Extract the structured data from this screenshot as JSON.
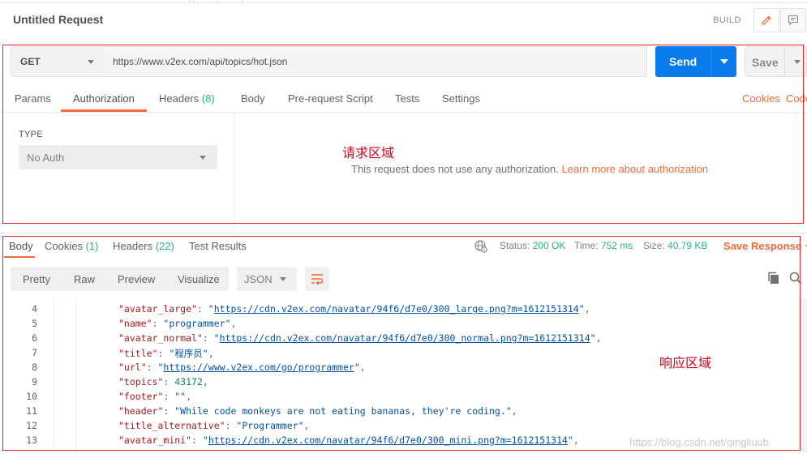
{
  "header": {
    "title": "Untitled Request",
    "build_label": "BUILD"
  },
  "request": {
    "method": "GET",
    "url": "https://www.v2ex.com/api/topics/hot.json",
    "send_label": "Send",
    "save_label": "Save",
    "tabs": [
      {
        "label": "Params"
      },
      {
        "label": "Authorization"
      },
      {
        "label": "Headers",
        "count": "(8)"
      },
      {
        "label": "Body"
      },
      {
        "label": "Pre-request Script"
      },
      {
        "label": "Tests"
      },
      {
        "label": "Settings"
      }
    ],
    "active_tab": "Authorization",
    "cookies_link": "Cookies",
    "code_link": "Code"
  },
  "auth": {
    "type_label": "TYPE",
    "type_value": "No Auth",
    "message": "This request does not use any authorization.",
    "learn_more": "Learn more about authorization"
  },
  "annotations": {
    "request_area": "请求区域",
    "response_area": "响应区域",
    "box_color": "#e8202a"
  },
  "response": {
    "tabs": [
      {
        "label": "Body"
      },
      {
        "label": "Cookies",
        "count": "(1)"
      },
      {
        "label": "Headers",
        "count": "(22)"
      },
      {
        "label": "Test Results"
      }
    ],
    "status_label": "Status:",
    "status_value": "200 OK",
    "time_label": "Time:",
    "time_value": "752 ms",
    "size_label": "Size:",
    "size_value": "40.79 KB",
    "save_response": "Save Response",
    "view_modes": [
      "Pretty",
      "Raw",
      "Preview",
      "Visualize"
    ],
    "format": "JSON",
    "code_lines": [
      {
        "n": "4",
        "key": "\"avatar_large\"",
        "type": "url",
        "value": "\"https://cdn.v2ex.com/navatar/94f6/d7e0/300_large.png?m=1612151314\""
      },
      {
        "n": "5",
        "key": "\"name\"",
        "type": "str",
        "value": "\"programmer\""
      },
      {
        "n": "6",
        "key": "\"avatar_normal\"",
        "type": "url",
        "value": "\"https://cdn.v2ex.com/navatar/94f6/d7e0/300_normal.png?m=1612151314\""
      },
      {
        "n": "7",
        "key": "\"title\"",
        "type": "str",
        "value": "\"程序员\""
      },
      {
        "n": "8",
        "key": "\"url\"",
        "type": "url",
        "value": "\"https://www.v2ex.com/go/programmer\""
      },
      {
        "n": "9",
        "key": "\"topics\"",
        "type": "num",
        "value": "43172"
      },
      {
        "n": "10",
        "key": "\"footer\"",
        "type": "str",
        "value": "\"\""
      },
      {
        "n": "11",
        "key": "\"header\"",
        "type": "str",
        "value": "\"While code monkeys are not eating bananas, they're coding.\""
      },
      {
        "n": "12",
        "key": "\"title_alternative\"",
        "type": "str",
        "value": "\"Programmer\""
      },
      {
        "n": "13",
        "key": "\"avatar_mini\"",
        "type": "url",
        "value": "\"https://cdn.v2ex.com/navatar/94f6/d7e0/300_mini.png?m=1612151314\""
      }
    ]
  },
  "watermark": "https://blog.csdn.net/qingliuub",
  "colors": {
    "accent": "#f26b3a",
    "send": "#097bed",
    "success": "#26b47f"
  }
}
